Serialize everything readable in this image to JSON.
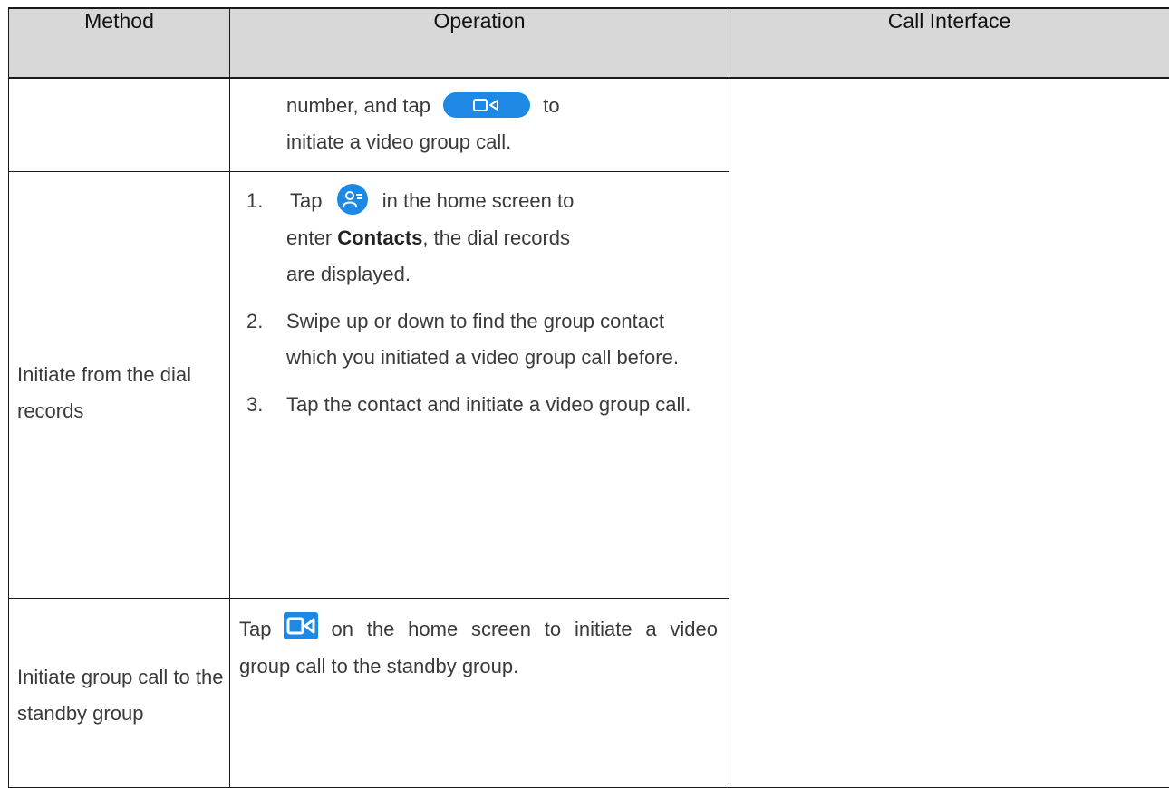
{
  "table": {
    "headers": {
      "method": "Method",
      "operation": "Operation",
      "call_interface": "Call Interface"
    },
    "rows": [
      {
        "method": "",
        "operation": {
          "line1_before": "number, and tap",
          "line1_after": "to",
          "line2": "initiate a video group call."
        }
      },
      {
        "method": "Initiate from the dial records",
        "steps": [
          {
            "num": "1.",
            "before_icon": "Tap",
            "after_icon": "in the home screen to",
            "line2_prefix": "enter",
            "bold": "Contacts",
            "line2_suffix": ", the dial records",
            "line3": "are displayed."
          },
          {
            "num": "2.",
            "text": "Swipe up or down to find the group contact which you initiated a video group call before."
          },
          {
            "num": "3.",
            "text": "Tap the contact and initiate a video group call."
          }
        ]
      },
      {
        "method": "Initiate group call to the standby group",
        "operation": {
          "before_icon": "Tap",
          "after_icon": "on the home screen to initiate a video group call to the standby group."
        }
      }
    ]
  },
  "icons": {
    "video_pill": "video-call-pill-icon",
    "contacts": "contacts-icon",
    "video": "video-camera-icon"
  },
  "colors": {
    "accent": "#1e88e5",
    "header_bg": "#d8d8d8"
  }
}
